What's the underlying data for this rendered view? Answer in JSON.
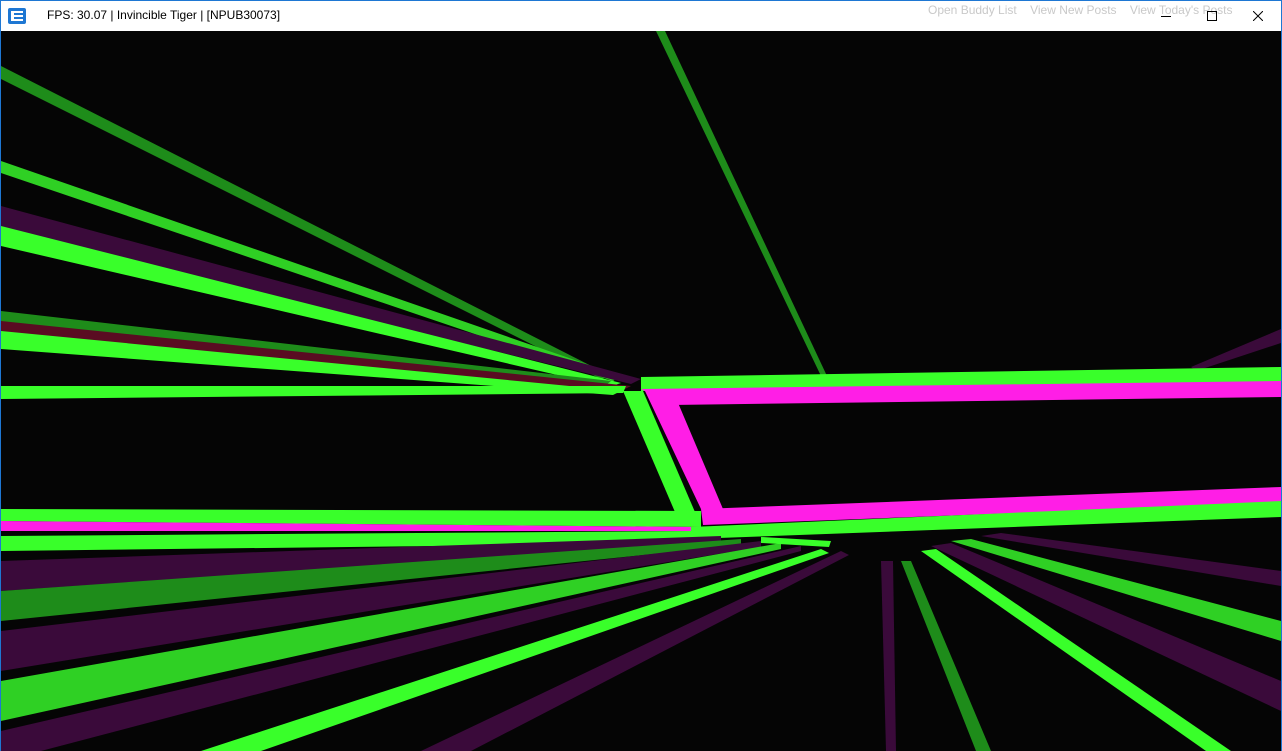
{
  "window": {
    "title": "FPS: 30.07 | Invincible Tiger | [NPUB30073]",
    "icon": "emulator-app-icon",
    "controls": {
      "minimize": "minimize-icon",
      "maximize": "maximize-icon",
      "close": "close-icon"
    }
  },
  "background_page": {
    "links": [
      "Open Buddy List",
      "View New Posts",
      "View Today's Posts"
    ]
  },
  "colors": {
    "neon_green": "#39ff2a",
    "dark_green": "#1e8c1a",
    "magenta": "#ff1ee6",
    "dark_purple": "#3a0a3a",
    "dark_red": "#5a0c22",
    "titlebar": "#ffffff",
    "border": "#1e77d3",
    "game_background": "#050505"
  }
}
